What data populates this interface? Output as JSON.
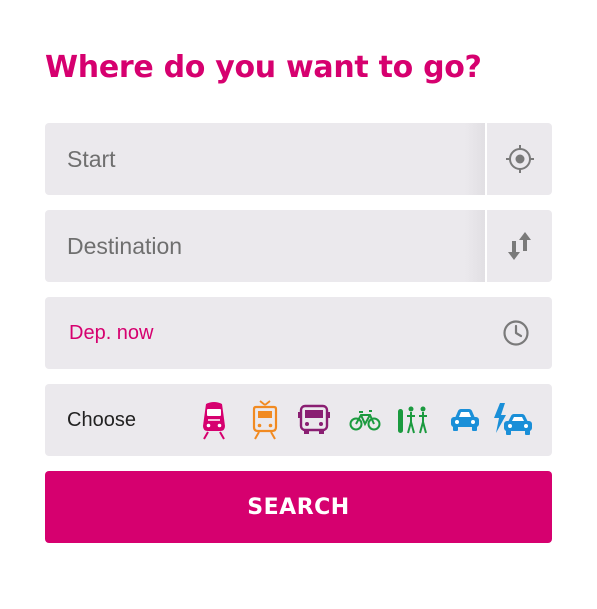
{
  "title": "Where do you want to go?",
  "start": {
    "placeholder": "Start",
    "locate_icon": "crosshair-location-icon"
  },
  "destination": {
    "placeholder": "Destination",
    "swap_icon": "swap-arrows-icon"
  },
  "departure": {
    "label": "Dep. now",
    "icon": "clock-icon"
  },
  "modes": {
    "label": "Choose",
    "items": [
      {
        "name": "train",
        "icon": "train-icon",
        "color": "#d6006f"
      },
      {
        "name": "tram",
        "icon": "tram-icon",
        "color": "#f18a21"
      },
      {
        "name": "bus",
        "icon": "bus-icon",
        "color": "#8a1e72"
      },
      {
        "name": "bike",
        "icon": "bicycle-icon",
        "color": "#1b9a3f"
      },
      {
        "name": "walk-bike",
        "icon": "walk-bike-icon",
        "color": "#1b9a3f"
      },
      {
        "name": "car",
        "icon": "car-icon",
        "color": "#1a8fd8"
      },
      {
        "name": "e-car",
        "icon": "electric-car-icon",
        "color": "#1a8fd8"
      }
    ]
  },
  "search": {
    "label": "SEARCH"
  },
  "colors": {
    "accent": "#d6006f",
    "field_bg": "#ebe9ed",
    "icon_gray": "#7a7a7a"
  }
}
